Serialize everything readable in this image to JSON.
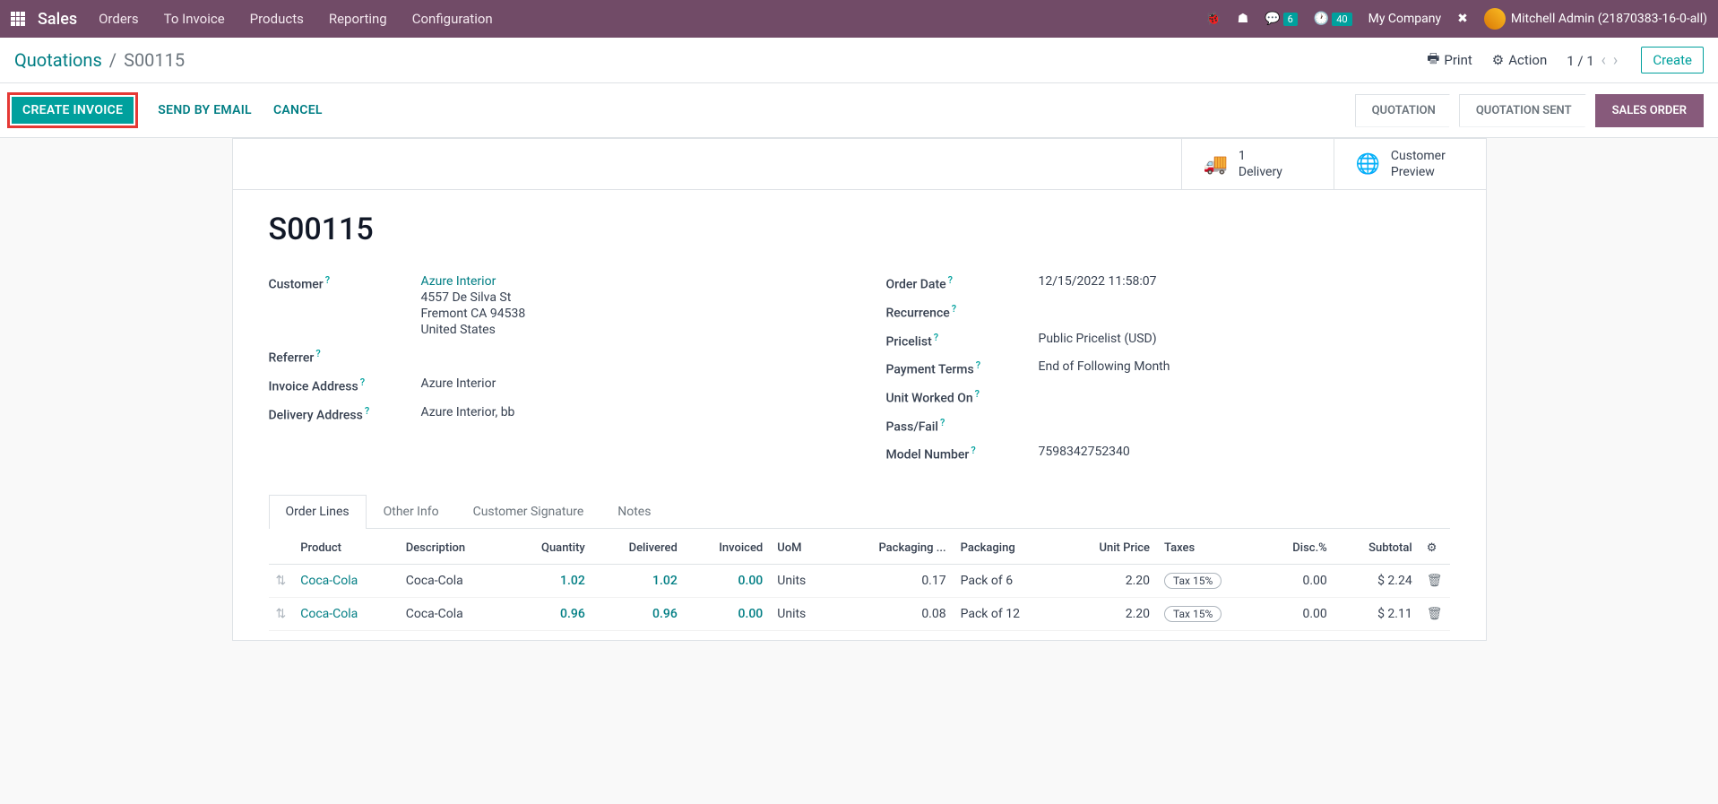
{
  "topbar": {
    "brand": "Sales",
    "menu": [
      "Orders",
      "To Invoice",
      "Products",
      "Reporting",
      "Configuration"
    ],
    "conv_badge": "6",
    "clock_badge": "40",
    "company": "My Company",
    "user": "Mitchell Admin (21870383-16-0-all)"
  },
  "breadcrumb": {
    "root": "Quotations",
    "current": "S00115",
    "print": "Print",
    "action": "Action",
    "pager": "1 / 1",
    "create": "Create"
  },
  "statusbar": {
    "create_invoice": "CREATE INVOICE",
    "send_email": "SEND BY EMAIL",
    "cancel": "CANCEL",
    "steps": [
      "QUOTATION",
      "QUOTATION SENT",
      "SALES ORDER"
    ]
  },
  "stats": {
    "delivery_count": "1",
    "delivery_label": "Delivery",
    "preview_l1": "Customer",
    "preview_l2": "Preview"
  },
  "record": {
    "title": "S00115"
  },
  "fields": {
    "customer_label": "Customer",
    "customer_name": "Azure Interior",
    "addr1": "4557 De Silva St",
    "addr2": "Fremont CA 94538",
    "addr3": "United States",
    "referrer_label": "Referrer",
    "invoice_addr_label": "Invoice Address",
    "invoice_addr": "Azure Interior",
    "delivery_addr_label": "Delivery Address",
    "delivery_addr": "Azure Interior, bb",
    "order_date_label": "Order Date",
    "order_date": "12/15/2022 11:58:07",
    "recurrence_label": "Recurrence",
    "pricelist_label": "Pricelist",
    "pricelist": "Public Pricelist (USD)",
    "payment_terms_label": "Payment Terms",
    "payment_terms": "End of Following Month",
    "unit_worked_label": "Unit Worked On",
    "passfail_label": "Pass/Fail",
    "model_num_label": "Model Number",
    "model_num": "7598342752340"
  },
  "tabs": [
    "Order Lines",
    "Other Info",
    "Customer Signature",
    "Notes"
  ],
  "table": {
    "headers": {
      "product": "Product",
      "description": "Description",
      "quantity": "Quantity",
      "delivered": "Delivered",
      "invoiced": "Invoiced",
      "uom": "UoM",
      "pkg_qty": "Packaging ...",
      "pkg": "Packaging",
      "unit_price": "Unit Price",
      "taxes": "Taxes",
      "disc": "Disc.%",
      "subtotal": "Subtotal"
    },
    "rows": [
      {
        "product": "Coca-Cola",
        "description": "Coca-Cola",
        "quantity": "1.02",
        "delivered": "1.02",
        "invoiced": "0.00",
        "uom": "Units",
        "pkg_qty": "0.17",
        "pkg": "Pack of 6",
        "unit_price": "2.20",
        "tax": "Tax 15%",
        "disc": "0.00",
        "subtotal": "$ 2.24"
      },
      {
        "product": "Coca-Cola",
        "description": "Coca-Cola",
        "quantity": "0.96",
        "delivered": "0.96",
        "invoiced": "0.00",
        "uom": "Units",
        "pkg_qty": "0.08",
        "pkg": "Pack of 12",
        "unit_price": "2.20",
        "tax": "Tax 15%",
        "disc": "0.00",
        "subtotal": "$ 2.11"
      }
    ]
  }
}
